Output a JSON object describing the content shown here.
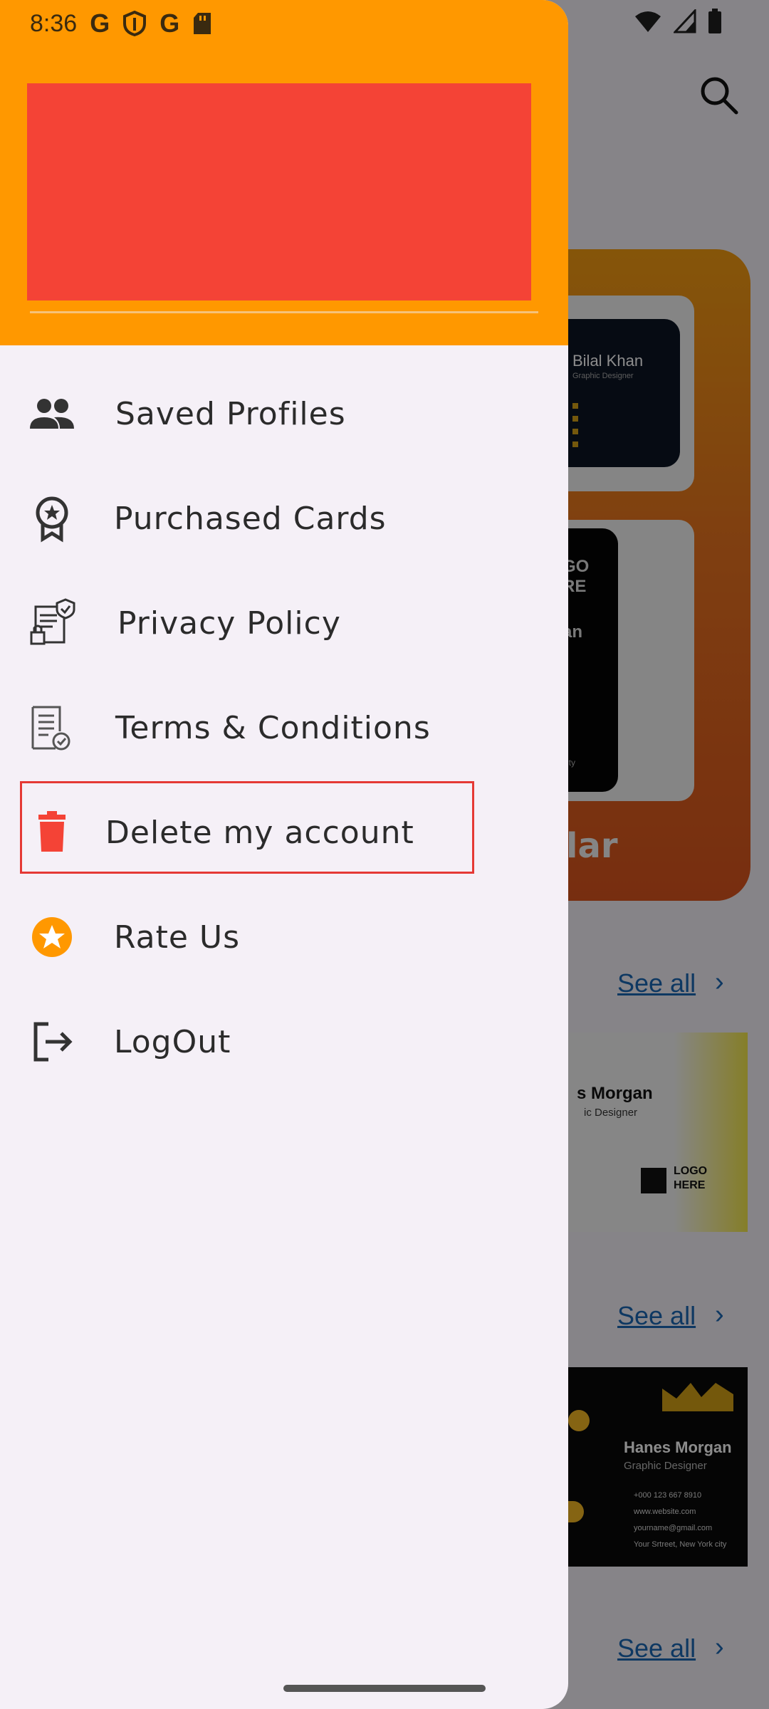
{
  "status_bar": {
    "time": "8:36",
    "left_icons": [
      "google-g-icon",
      "shield-icon",
      "google-g-icon",
      "sd-card-icon"
    ],
    "right_icons": [
      "wifi-icon",
      "signal-icon",
      "battery-icon"
    ]
  },
  "colors": {
    "drawer_header": "#ff9800",
    "header_block": "#f44336",
    "drawer_bg": "#f5f0f7",
    "highlight_border": "#e53935",
    "delete_icon": "#f44336",
    "rate_icon": "#ff9800"
  },
  "drawer": {
    "items": [
      {
        "label": "Saved Profiles",
        "icon": "people-icon"
      },
      {
        "label": "Purchased Cards",
        "icon": "award-badge-icon"
      },
      {
        "label": "Privacy Policy",
        "icon": "privacy-document-icon"
      },
      {
        "label": "Terms & Conditions",
        "icon": "terms-document-icon"
      },
      {
        "label": "Delete my account",
        "icon": "trash-icon"
      },
      {
        "label": "Rate Us",
        "icon": "star-circle-icon"
      },
      {
        "label": "LogOut",
        "icon": "logout-icon"
      }
    ]
  },
  "background": {
    "hero_text": "lar",
    "card1": {
      "name": "Bilal Khan",
      "role": "Graphic Designer"
    },
    "card2": {
      "logo_top": "GO",
      "logo_bottom": "RE",
      "name_fragment": "an",
      "city_fragment": "city"
    },
    "see_all": [
      "See all",
      "See all",
      "See all"
    ],
    "promo_card": {
      "name": "s Morgan",
      "role": "ic Designer",
      "logo_top": "LOGO",
      "logo_bottom": "HERE"
    },
    "black_card": {
      "name": "Hanes Morgan",
      "role": "Graphic Designer",
      "phone": "+000 123 667 8910",
      "web": "www.website.com",
      "email": "yourname@gmail.com",
      "address": "Your Srtreet, New York city"
    }
  }
}
